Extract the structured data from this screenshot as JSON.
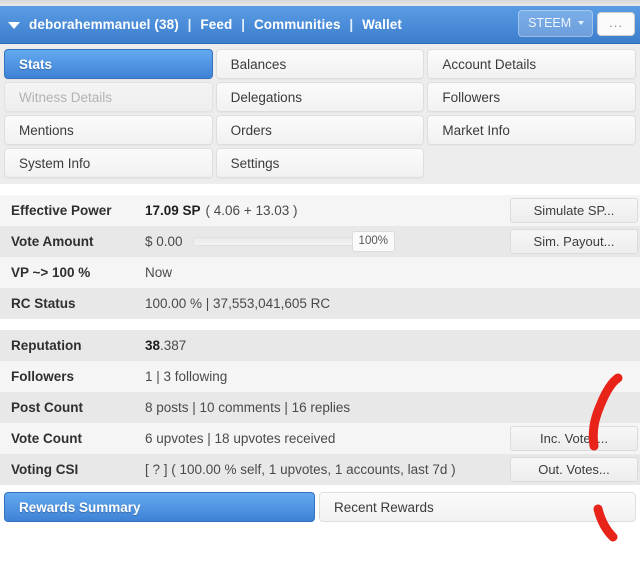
{
  "header": {
    "menu_caret_icon": "triangle-down-icon",
    "username": "deborahemmanuel (38)",
    "links": [
      "Feed",
      "Communities",
      "Wallet"
    ],
    "separator": "|",
    "token_selector": "STEEM",
    "token_caret_icon": "caret-down-icon",
    "overflow_label": "...",
    "bar_color": "#5b9ce5"
  },
  "tabs": [
    {
      "label": "Stats",
      "state": "active"
    },
    {
      "label": "Balances",
      "state": "normal"
    },
    {
      "label": "Account Details",
      "state": "normal"
    },
    {
      "label": "Witness Details",
      "state": "disabled"
    },
    {
      "label": "Delegations",
      "state": "normal"
    },
    {
      "label": "Followers",
      "state": "normal"
    },
    {
      "label": "Mentions",
      "state": "normal"
    },
    {
      "label": "Orders",
      "state": "normal"
    },
    {
      "label": "Market Info",
      "state": "normal"
    },
    {
      "label": "System Info",
      "state": "normal"
    },
    {
      "label": "Settings",
      "state": "normal"
    },
    {
      "label": "",
      "state": "empty"
    }
  ],
  "stats_top": {
    "rows": [
      {
        "label": "Effective Power",
        "value_bold": "17.09 SP",
        "value_rest": "( 4.06 + 13.03 )",
        "button": "Simulate SP..."
      },
      {
        "label": "Vote Amount",
        "value_bold": "$ 0.00",
        "slider_percent": "100%",
        "button": "Sim. Payout..."
      },
      {
        "label": "VP ~> 100 %",
        "value_rest": "Now"
      },
      {
        "label": "RC Status",
        "value_rest": "100.00 %  |  37,553,041,605 RC"
      }
    ]
  },
  "stats_bottom": {
    "rows": [
      {
        "label": "Reputation",
        "value_bold": "38",
        "value_rest": ".387"
      },
      {
        "label": "Followers",
        "value_rest": "1  |  3 following"
      },
      {
        "label": "Post Count",
        "value_rest": "8 posts  |  10 comments  |  16 replies"
      },
      {
        "label": "Vote Count",
        "value_rest": "6 upvotes  |  18 upvotes received",
        "button": "Inc. Votes..."
      },
      {
        "label": "Voting CSI",
        "value_rest": "[ ? ] ( 100.00 % self, 1 upvotes, 1 accounts, last 7d )",
        "button": "Out. Votes..."
      }
    ]
  },
  "bottom_tabs": [
    {
      "label": "Rewards Summary",
      "state": "active"
    },
    {
      "label": "Recent Rewards",
      "state": "normal"
    }
  ],
  "annotation": {
    "color": "#e8231a",
    "marks": [
      "upward-stroke-upper",
      "short-stroke-lower"
    ]
  }
}
